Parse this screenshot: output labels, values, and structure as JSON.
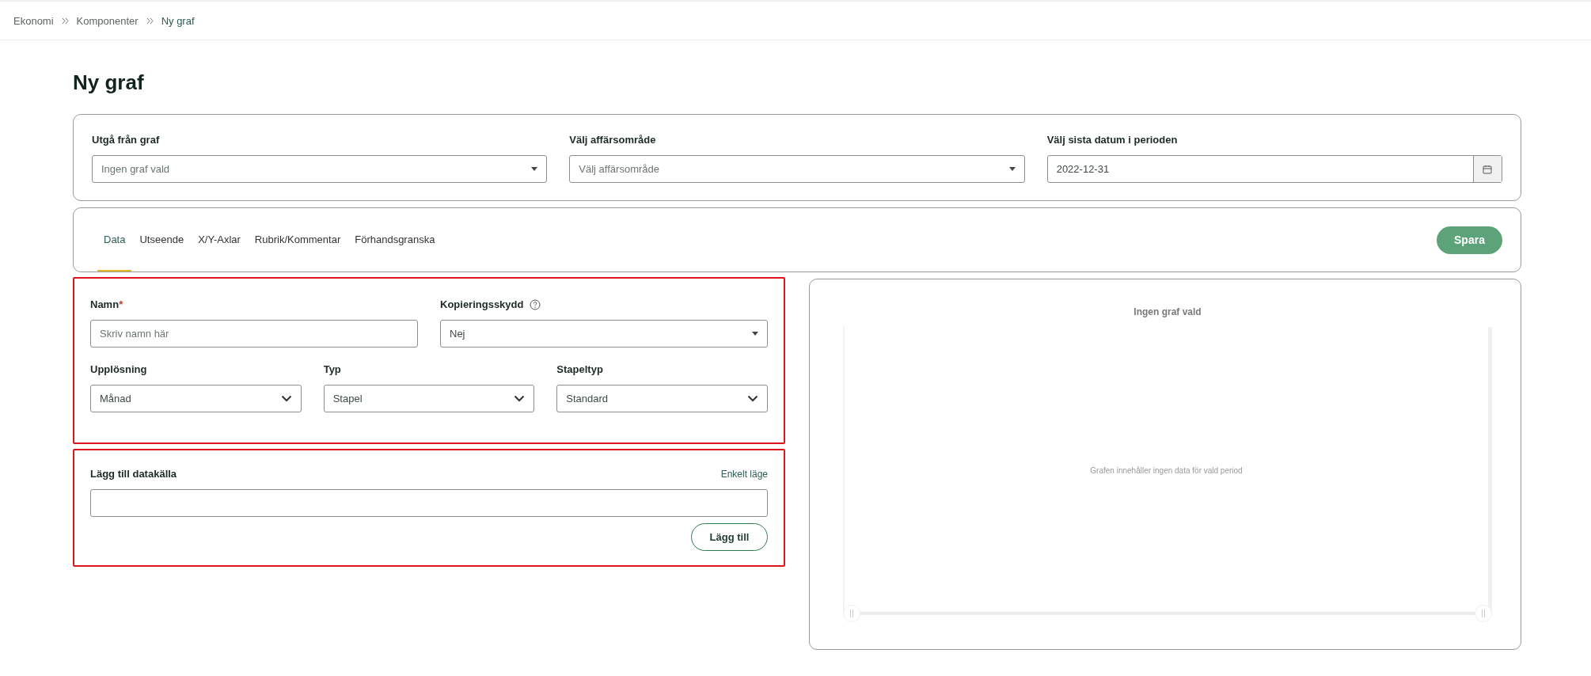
{
  "breadcrumb": [
    {
      "label": "Ekonomi",
      "current": false
    },
    {
      "label": "Komponenter",
      "current": false
    },
    {
      "label": "Ny graf",
      "current": true
    }
  ],
  "page_title": "Ny graf",
  "filters": [
    {
      "kind": "select",
      "label": "Utgå från graf",
      "placeholder": "Ingen graf vald"
    },
    {
      "kind": "select",
      "label": "Välj affärsområde",
      "placeholder": "Välj affärsområde"
    },
    {
      "kind": "date",
      "label": "Välj sista datum i perioden",
      "value": "2022-12-31"
    }
  ],
  "tabs": [
    {
      "label": "Data",
      "selected": true
    },
    {
      "label": "Utseende",
      "selected": false
    },
    {
      "label": "X/Y-Axlar",
      "selected": false
    },
    {
      "label": "Rubrik/Kommentar",
      "selected": false
    },
    {
      "label": "Förhandsgranska",
      "selected": false
    }
  ],
  "save_button": "Spara",
  "settings": {
    "highlighted": true,
    "name": {
      "label": "Namn",
      "required_mark": "*",
      "placeholder": "Skriv namn här"
    },
    "copy_protection": {
      "label": "Kopieringsskydd",
      "value": "Nej"
    },
    "selects": [
      {
        "label": "Upplösning",
        "value": "Månad"
      },
      {
        "label": "Typ",
        "value": "Stapel"
      },
      {
        "label": "Stapeltyp",
        "value": "Standard"
      }
    ]
  },
  "datasource": {
    "highlighted": true,
    "label": "Lägg till datakälla",
    "mode_link": "Enkelt läge",
    "add_button": "Lägg till"
  },
  "preview": {
    "title": "Ingen graf vald",
    "empty_message": "Grafen innehåller ingen data för vald period"
  }
}
